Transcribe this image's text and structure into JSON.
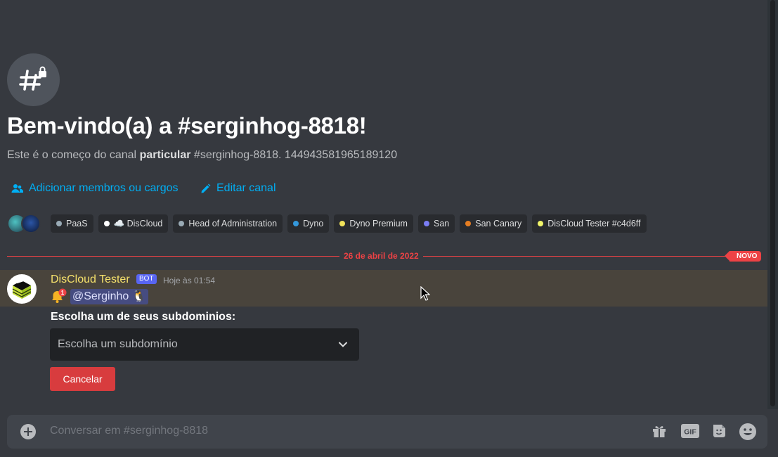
{
  "channel": {
    "welcome_title": "Bem-vindo(a) a #serginhog-8818!",
    "sub_prefix": "Este é o começo do canal ",
    "sub_bold": "particular",
    "sub_suffix": " #serginhog-8818. 144943581965189120"
  },
  "actions": {
    "add_members": "Adicionar membros ou cargos",
    "edit_channel": "Editar canal"
  },
  "roles": [
    {
      "name": "PaaS",
      "color": "#99aab5"
    },
    {
      "name": "☁️ DisCloud",
      "color": "#ffffff"
    },
    {
      "name": "Head of Administration",
      "color": "#99aab5"
    },
    {
      "name": "Dyno",
      "color": "#3498db"
    },
    {
      "name": "Dyno Premium",
      "color": "#f1e35a"
    },
    {
      "name": "San",
      "color": "#7b7ef5"
    },
    {
      "name": "San Canary",
      "color": "#e67e22"
    },
    {
      "name": "DisCloud Tester #c4d6ff",
      "color": "#f1f56a"
    }
  ],
  "divider": {
    "date": "26 de abril de 2022",
    "new_label": "NOVO"
  },
  "message": {
    "author": "DisCloud Tester",
    "bot_tag": "BOT",
    "time": "Hoje às 01:54",
    "mention": "@Serginho 🐧",
    "bell_badge": "1"
  },
  "embed": {
    "label": "Escolha um de seus subdominios:",
    "select_placeholder": "Escolha um subdomínio",
    "cancel_label": "Cancelar"
  },
  "composer": {
    "placeholder": "Conversar em #serginhog-8818",
    "gif_label": "GIF"
  },
  "colors": {
    "accent_link": "#00aff4",
    "new_red": "#ed4245",
    "bot_blurple": "#5865f2",
    "highlight": "#49443c"
  }
}
